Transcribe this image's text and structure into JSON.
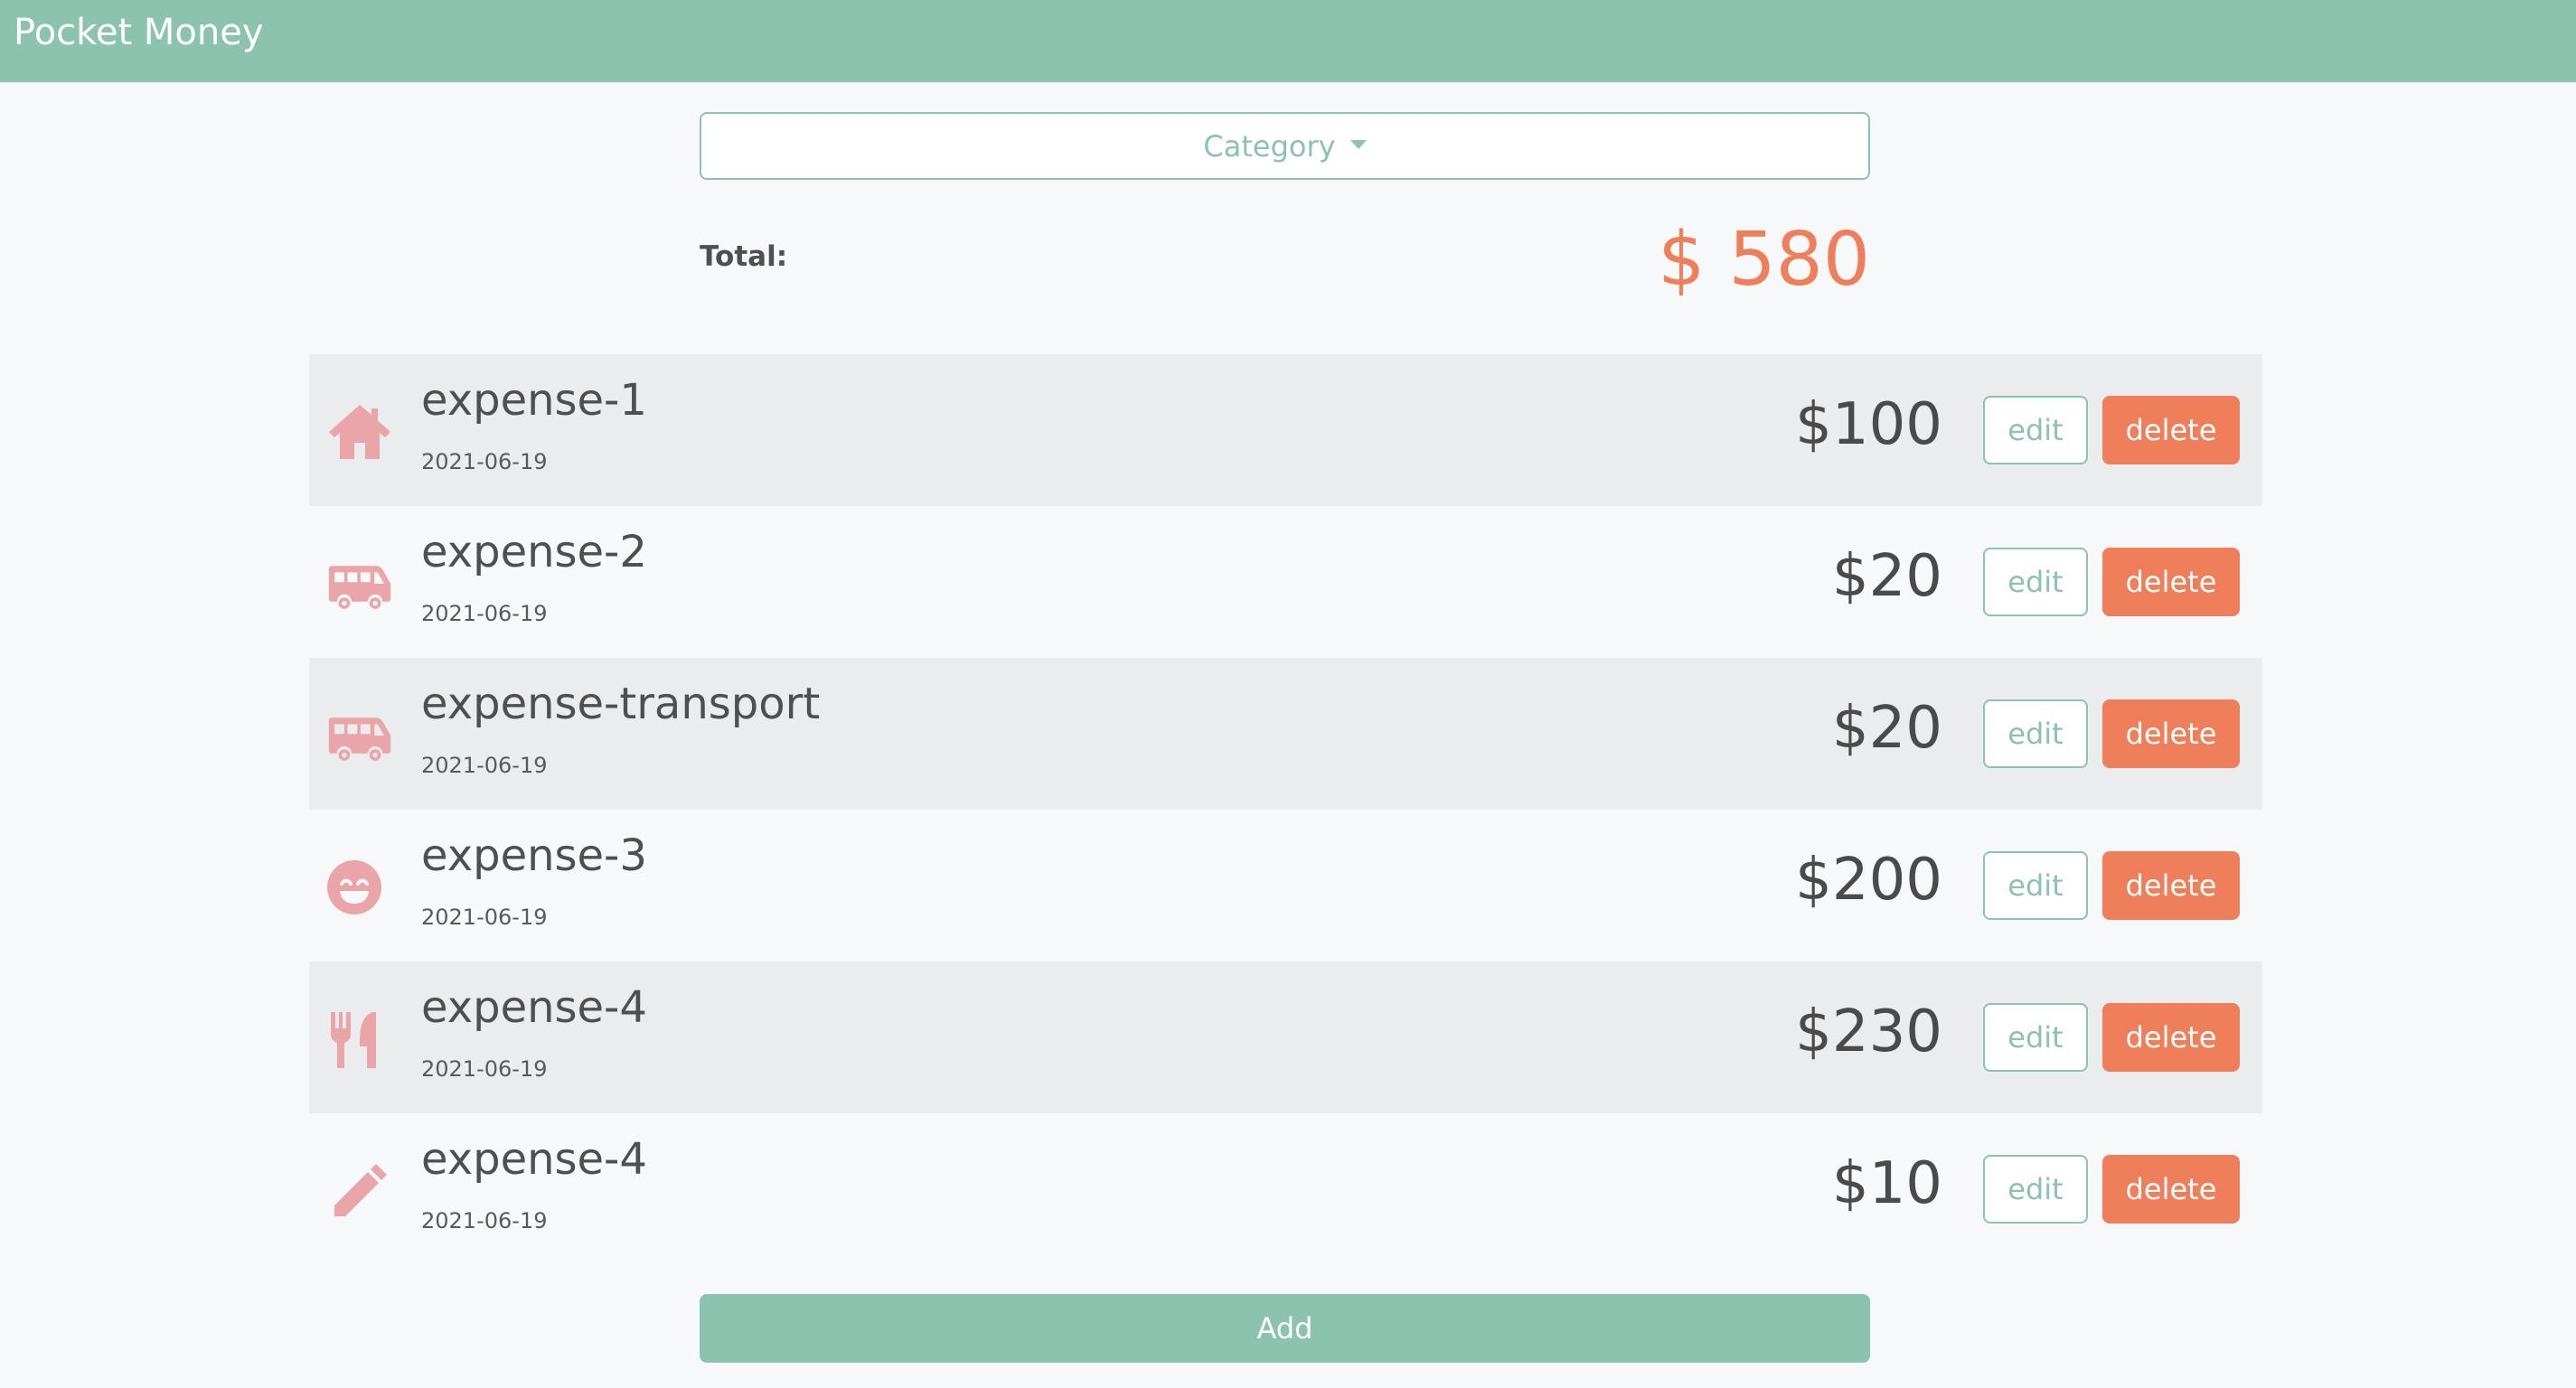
{
  "app": {
    "title": "Pocket Money"
  },
  "filter": {
    "label": "Category"
  },
  "summary": {
    "total_label": "Total:",
    "total_value": "$ 580"
  },
  "expenses": [
    {
      "title": "expense-1",
      "date": "2021-06-19",
      "amount": "$100",
      "icon": "home-icon"
    },
    {
      "title": "expense-2",
      "date": "2021-06-19",
      "amount": "$20",
      "icon": "bus-icon"
    },
    {
      "title": "expense-transport",
      "date": "2021-06-19",
      "amount": "$20",
      "icon": "bus-icon"
    },
    {
      "title": "expense-3",
      "date": "2021-06-19",
      "amount": "$200",
      "icon": "smile-icon"
    },
    {
      "title": "expense-4",
      "date": "2021-06-19",
      "amount": "$230",
      "icon": "utensils-icon"
    },
    {
      "title": "expense-4",
      "date": "2021-06-19",
      "amount": "$10",
      "icon": "pencil-icon"
    }
  ],
  "actions": {
    "edit_label": "edit",
    "delete_label": "delete",
    "add_label": "Add"
  },
  "colors": {
    "primary": "#8bc3ae",
    "accent": "#ef7f5a",
    "icon": "#eaa5a8"
  }
}
